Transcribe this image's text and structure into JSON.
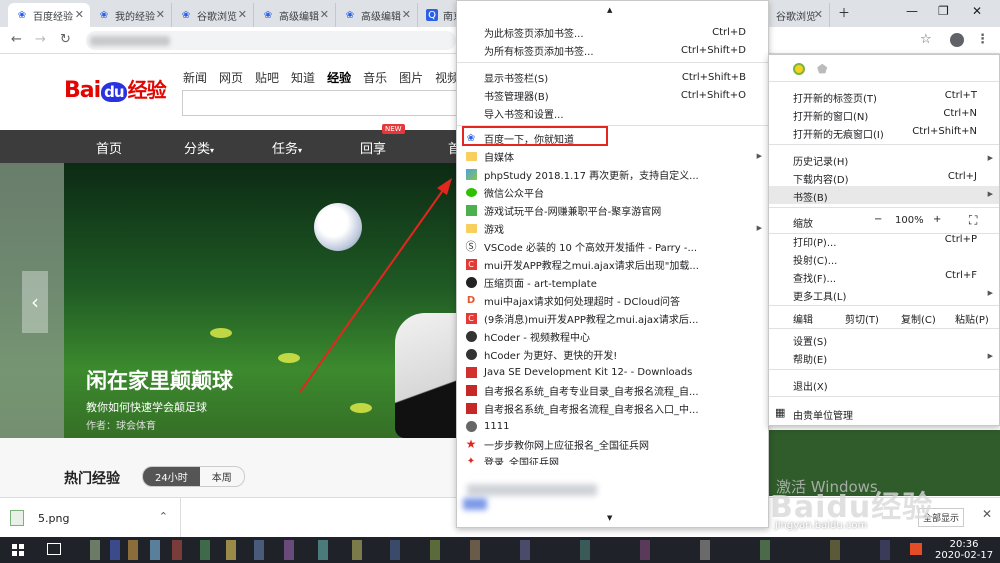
{
  "tabs": [
    {
      "title": "百度经验"
    },
    {
      "title": "我的经验"
    },
    {
      "title": "谷歌浏览"
    },
    {
      "title": "高级编辑"
    },
    {
      "title": "高级编辑"
    },
    {
      "title": "南京"
    },
    {
      "title": "谷歌浏览"
    }
  ],
  "page": {
    "logo_bai": "Bai",
    "logo_du": "du",
    "logo_jy": "经验",
    "topnav": [
      "新闻",
      "网页",
      "贴吧",
      "知道",
      "经验",
      "音乐",
      "图片",
      "视频"
    ],
    "menubar": [
      "首页",
      "分类",
      "任务",
      "回享"
    ],
    "new_badge": "NEW",
    "hero_title": "闲在家里颠颠球",
    "hero_sub": "教你如何快速学会颠足球",
    "hero_author": "作者：球会体育",
    "hot_title": "热门经验",
    "hot_tabs": [
      "24小时",
      "本周"
    ]
  },
  "bookmarks_menu": {
    "actions": [
      {
        "label": "为此标签页添加书签...",
        "shortcut": "Ctrl+D"
      },
      {
        "label": "为所有标签页添加书签...",
        "shortcut": "Ctrl+Shift+D"
      },
      {
        "label": "显示书签栏(S)",
        "shortcut": "Ctrl+Shift+B"
      },
      {
        "label": "书签管理器(B)",
        "shortcut": "Ctrl+Shift+O"
      },
      {
        "label": "导入书签和设置...",
        "shortcut": ""
      }
    ],
    "items": [
      {
        "label": "百度一下，你就知道",
        "icon": "baidu-paw-icon"
      },
      {
        "label": "自媒体",
        "icon": "folder-icon",
        "submenu": true
      },
      {
        "label": "phpStudy 2018.1.17 再次更新，支持自定义...",
        "icon": "phpstudy-icon"
      },
      {
        "label": "微信公众平台",
        "icon": "wechat-icon"
      },
      {
        "label": "游戏试玩平台-网赚兼职平台-聚享游官网",
        "icon": "game-icon"
      },
      {
        "label": "游戏",
        "icon": "folder-icon",
        "submenu": true
      },
      {
        "label": "VSCode 必装的 10 个高效开发插件 - Parry -...",
        "icon": "vscode-icon"
      },
      {
        "label": "mui开发APP教程之mui.ajax请求后出现\"加载...",
        "icon": "csdn-icon"
      },
      {
        "label": "压缩页面 - art-template",
        "icon": "github-icon"
      },
      {
        "label": "mui中ajax请求如何处理超时 - DCloud问答",
        "icon": "dcloud-icon"
      },
      {
        "label": "(9条消息)mui开发APP教程之mui.ajax请求后...",
        "icon": "csdn-icon"
      },
      {
        "label": "hCoder - 视频教程中心",
        "icon": "hcoder-icon"
      },
      {
        "label": "hCoder 为更好、更快的开发!",
        "icon": "hcoder-icon"
      },
      {
        "label": "Java SE Development Kit 12- - Downloads",
        "icon": "oracle-icon"
      },
      {
        "label": "自考报名系统_自考专业目录_自考报名流程_自...",
        "icon": "zikao-icon"
      },
      {
        "label": "自考报名系统_自考报名流程_自考报名入口_中...",
        "icon": "zikao-icon"
      },
      {
        "label": "1111",
        "icon": "globe-icon"
      },
      {
        "label": "一步步教你网上应征报名_全国征兵网",
        "icon": "star-icon"
      },
      {
        "label": "登录_全国征兵网",
        "icon": "zhengbing-icon"
      }
    ]
  },
  "chrome_menu": {
    "rows": [
      {
        "label": "打开新的标签页(T)",
        "shortcut": "Ctrl+T"
      },
      {
        "label": "打开新的窗口(N)",
        "shortcut": "Ctrl+N"
      },
      {
        "label": "打开新的无痕窗口(I)",
        "shortcut": "Ctrl+Shift+N"
      },
      {
        "label": "历史记录(H)",
        "shortcut": ""
      },
      {
        "label": "下载内容(D)",
        "shortcut": "Ctrl+J"
      },
      {
        "label": "书签(B)",
        "shortcut": ""
      },
      {
        "label": "打印(P)...",
        "shortcut": "Ctrl+P"
      },
      {
        "label": "投射(C)...",
        "shortcut": ""
      },
      {
        "label": "查找(F)...",
        "shortcut": "Ctrl+F"
      },
      {
        "label": "更多工具(L)",
        "shortcut": ""
      },
      {
        "label": "设置(S)",
        "shortcut": ""
      },
      {
        "label": "帮助(E)",
        "shortcut": ""
      },
      {
        "label": "退出(X)",
        "shortcut": ""
      },
      {
        "label": "由贵单位管理",
        "shortcut": ""
      }
    ],
    "zoom_label": "缩放",
    "zoom_minus": "−",
    "zoom_value": "100%",
    "zoom_plus": "+",
    "edit_label": "编辑",
    "cut": "剪切(T)",
    "copy": "复制(C)",
    "paste": "粘贴(P)"
  },
  "download": {
    "filename": "5.png",
    "show_all": "全部显示"
  },
  "watermark": {
    "activate": "激活 Windows",
    "logo": "Baidu经验",
    "url": "jingyan.baidu.com"
  },
  "taskbar": {
    "time": "20:36",
    "date": "2020-02-17"
  },
  "colors": {
    "highlight_box": "#e3261e",
    "annotation_arrow": "#e3261e",
    "baidu_red": "#e10602",
    "baidu_blue": "#2932e1"
  }
}
